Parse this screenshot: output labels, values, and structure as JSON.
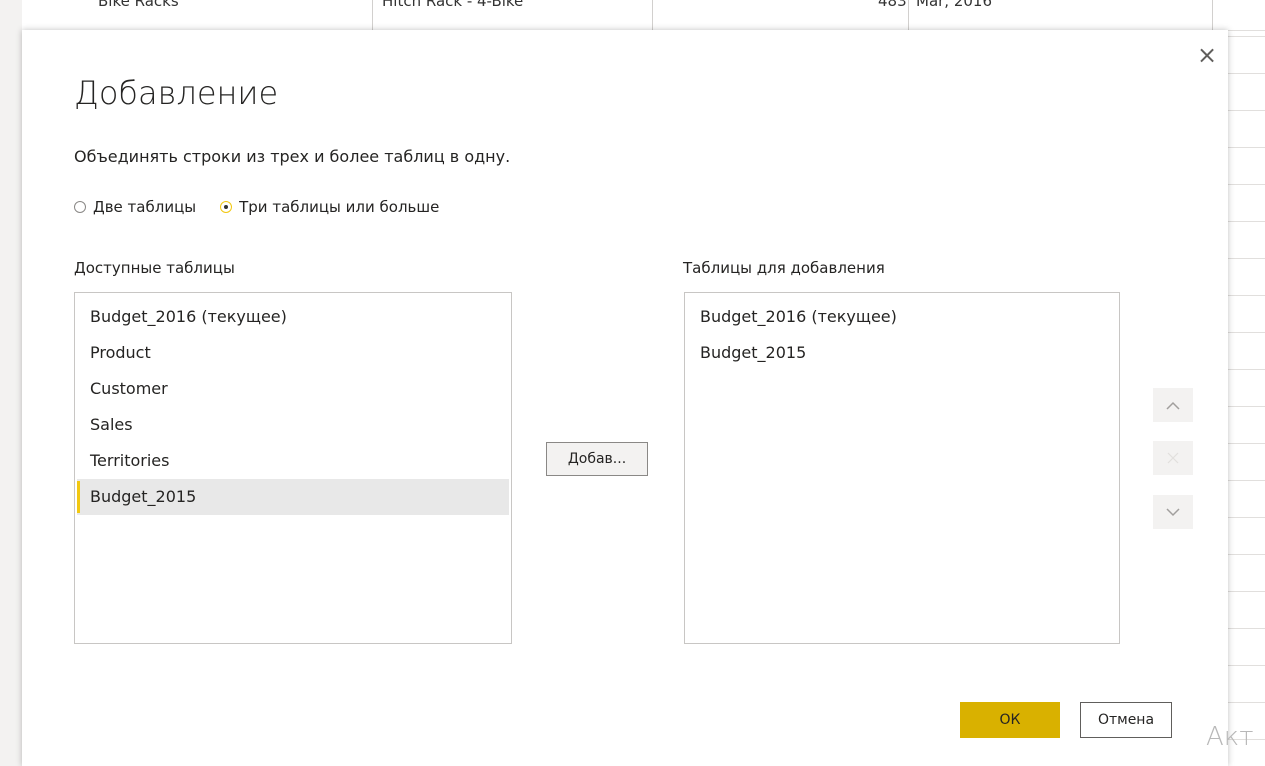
{
  "background": {
    "row_cells": [
      "Bike Racks",
      "Hitch Rack - 4-Bike",
      "483",
      "Mar, 2016"
    ]
  },
  "dialog": {
    "title": "Добавление",
    "description": "Объединять строки из трех и более таблиц в одну.",
    "close_icon": "×",
    "radio_options": [
      {
        "label": "Две таблицы",
        "checked": false
      },
      {
        "label": "Три таблицы или больше",
        "checked": true
      }
    ],
    "available_label": "Доступные таблицы",
    "available_tables": [
      "Budget_2016 (текущее)",
      "Product",
      "Customer",
      "Sales",
      "Territories",
      "Budget_2015"
    ],
    "selected_available": "Budget_2015",
    "append_label": "Таблицы для добавления",
    "append_tables": [
      "Budget_2016 (текущее)",
      "Budget_2015"
    ],
    "add_button": "Добав...",
    "ok_button": "ОК",
    "cancel_button": "Отмена"
  },
  "watermark": "Акт",
  "colors": {
    "accent": "#f2c811",
    "ok_button": "#d9b100",
    "selection": "#e8e8e8"
  }
}
